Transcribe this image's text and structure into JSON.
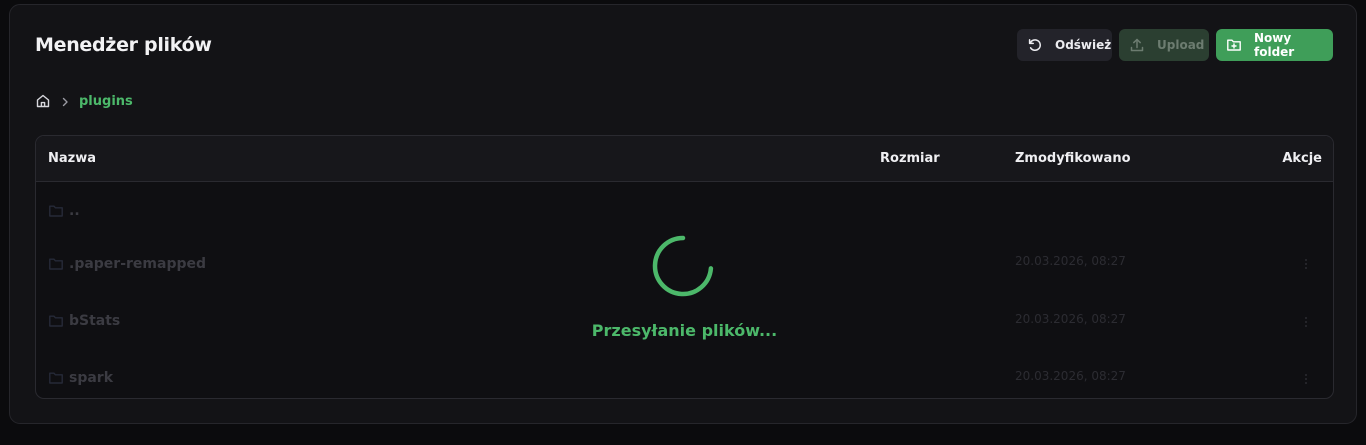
{
  "page": {
    "title": "Menedżer plików"
  },
  "toolbar": {
    "refresh_label": "Odśwież",
    "upload_label": "Upload",
    "new_folder_label": "Nowy folder"
  },
  "breadcrumb": {
    "home_icon": "home-icon",
    "current": "plugins"
  },
  "table": {
    "columns": {
      "name": "Nazwa",
      "size": "Rozmiar",
      "modified": "Zmodyfikowano",
      "actions": "Akcje"
    },
    "rows": [
      {
        "name": "..",
        "modified": ""
      },
      {
        "name": ".paper-remapped",
        "modified": "20.03.2026, 08:27"
      },
      {
        "name": "bStats",
        "modified": "20.03.2026, 08:27"
      },
      {
        "name": "spark",
        "modified": "20.03.2026, 08:27"
      }
    ]
  },
  "loading": {
    "text": "Przesyłanie plików..."
  },
  "colors": {
    "accent": "#4cb86a",
    "button_primary": "#3f9e59",
    "background": "#131316"
  }
}
